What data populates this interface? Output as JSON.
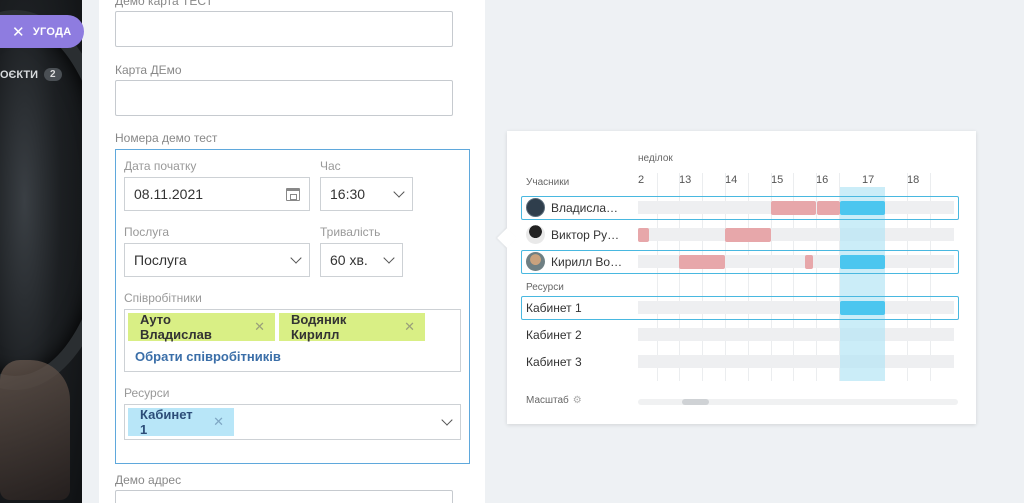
{
  "sidebar": {
    "deal_button": "УГОДА",
    "projects_label": "ОЄКТИ",
    "projects_count": "2"
  },
  "form": {
    "demo_card_test_label": "Демо карта ТЕСТ",
    "card_demo_label": "Карта ДЕмо",
    "demo_numbers_label": "Номера демо тест",
    "start_date_label": "Дата початку",
    "start_date_value": "08.11.2021",
    "time_label": "Час",
    "time_value": "16:30",
    "service_label": "Послуга",
    "service_value": "Послуга",
    "duration_label": "Тривалість",
    "duration_value": "60 хв.",
    "employees_label": "Співробітники",
    "employees": [
      "Ауто Владислав",
      "Водяник Кирилл"
    ],
    "choose_employees": "Обрати співробітників",
    "resources_label": "Ресурси",
    "resources": [
      "Кабинет 1"
    ],
    "demo_address_label": "Демо адрес"
  },
  "timeline": {
    "day_label": "неділок",
    "participants_header": "Учасники",
    "hours": [
      "2",
      "13",
      "14",
      "15",
      "16",
      "17",
      "18"
    ],
    "participants": [
      "Владисла…",
      "Виктор Ру…",
      "Кирилл Во…"
    ],
    "resources_header": "Ресурси",
    "resources": [
      "Кабинет 1",
      "Кабинет 2",
      "Кабинет 3"
    ],
    "scale_label": "Масштаб",
    "colors": {
      "busy": "#e7a7aa",
      "selected": "#4bc6ef",
      "highlight": "#b5e6f5"
    }
  }
}
